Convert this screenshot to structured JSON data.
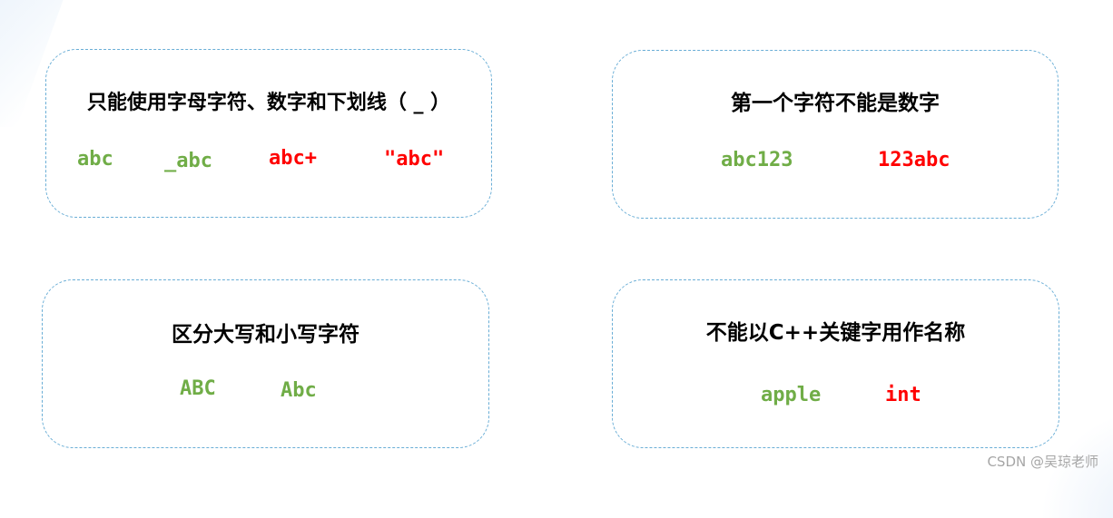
{
  "colors": {
    "border": "#6aaed6",
    "valid": "#70ad47",
    "invalid": "#ff0000",
    "title": "#000000"
  },
  "cards": [
    {
      "title": "只能使用字母字符、数字和下划线（ _ ）",
      "examples": [
        {
          "text": "abc",
          "status": "valid"
        },
        {
          "text": "_abc",
          "status": "valid"
        },
        {
          "text": "abc+",
          "status": "invalid"
        },
        {
          "text": "\"abc\"",
          "status": "invalid"
        }
      ]
    },
    {
      "title": "第一个字符不能是数字",
      "examples": [
        {
          "text": "abc123",
          "status": "valid"
        },
        {
          "text": "123abc",
          "status": "invalid"
        }
      ]
    },
    {
      "title": "区分大写和小写字符",
      "examples": [
        {
          "text": "ABC",
          "status": "valid"
        },
        {
          "text": "Abc",
          "status": "valid"
        }
      ]
    },
    {
      "title": "不能以C++关键字用作名称",
      "examples": [
        {
          "text": "apple",
          "status": "valid"
        },
        {
          "text": "int",
          "status": "invalid"
        }
      ]
    }
  ],
  "watermark": "CSDN @吴琼老师"
}
